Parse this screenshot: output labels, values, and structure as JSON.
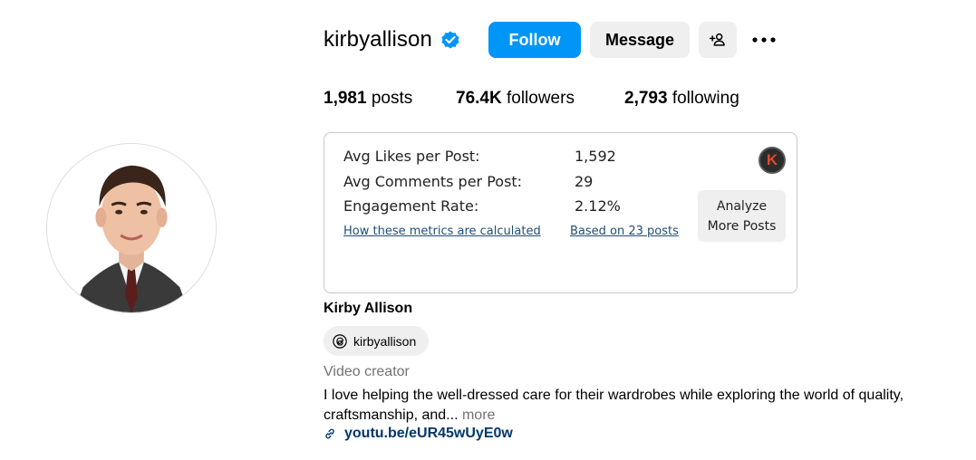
{
  "profile": {
    "username": "kirbyallison",
    "verified": true,
    "full_name": "Kirby Allison",
    "category": "Video creator",
    "bio": "I love helping the well-dressed care for their wardrobes while exploring the world of quality, craftsmanship, and...",
    "bio_more": "more",
    "link_text": "youtu.be/eUR45wUyE0w",
    "threads_handle": "kirbyallison"
  },
  "actions": {
    "follow_label": "Follow",
    "message_label": "Message",
    "add_user_icon": "add-person-icon",
    "more_icon": "more-options-icon"
  },
  "stats": {
    "posts_count": "1,981",
    "posts_label": "posts",
    "followers_count": "76.4K",
    "followers_label": "followers",
    "following_count": "2,793",
    "following_label": "following"
  },
  "metrics": {
    "rows": [
      {
        "label": "Avg Likes per Post:",
        "value": "1,592"
      },
      {
        "label": "Avg Comments per Post:",
        "value": "29"
      },
      {
        "label": "Engagement Rate:",
        "value": "2.12%"
      }
    ],
    "how_link": "How these metrics are calculated",
    "based_on_link": "Based on 23 posts",
    "analyze_label": "Analyze\nMore Posts",
    "badge_letter": "K"
  },
  "colors": {
    "accent": "#0095f6",
    "button_gray": "#efefef",
    "link_blue": "#00376b",
    "muted": "#737373"
  }
}
